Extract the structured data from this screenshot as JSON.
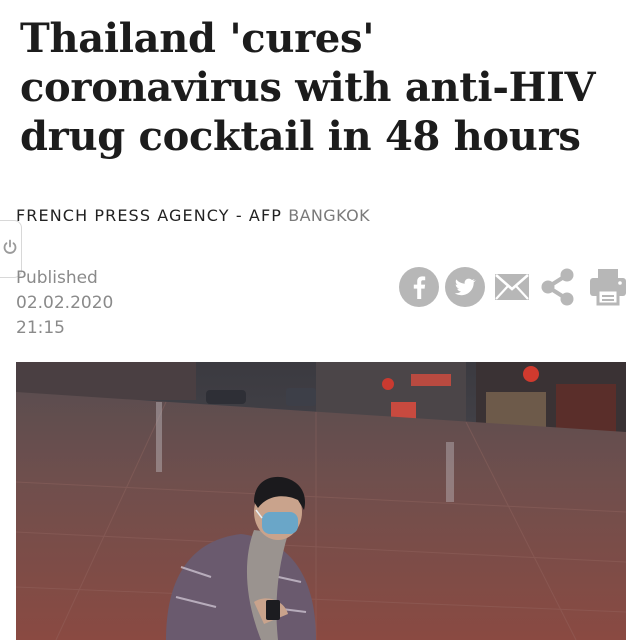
{
  "article": {
    "headline": [
      "Thailand 'cures'",
      "coronavirus with anti-HIV",
      "drug cocktail in 48 hours"
    ],
    "byline": {
      "agency": "FRENCH PRESS AGENCY - AFP",
      "location": "BANGKOK"
    },
    "published": {
      "label": "Published",
      "date": "02.02.2020",
      "time": "21:15"
    }
  },
  "share_icons": [
    "facebook-icon",
    "twitter-icon",
    "email-icon",
    "share-icon",
    "print-icon"
  ],
  "colors": {
    "headline": "#1c1c1c",
    "meta_gray": "#8a8a8a",
    "icon_gray": "#b7b7b7"
  }
}
